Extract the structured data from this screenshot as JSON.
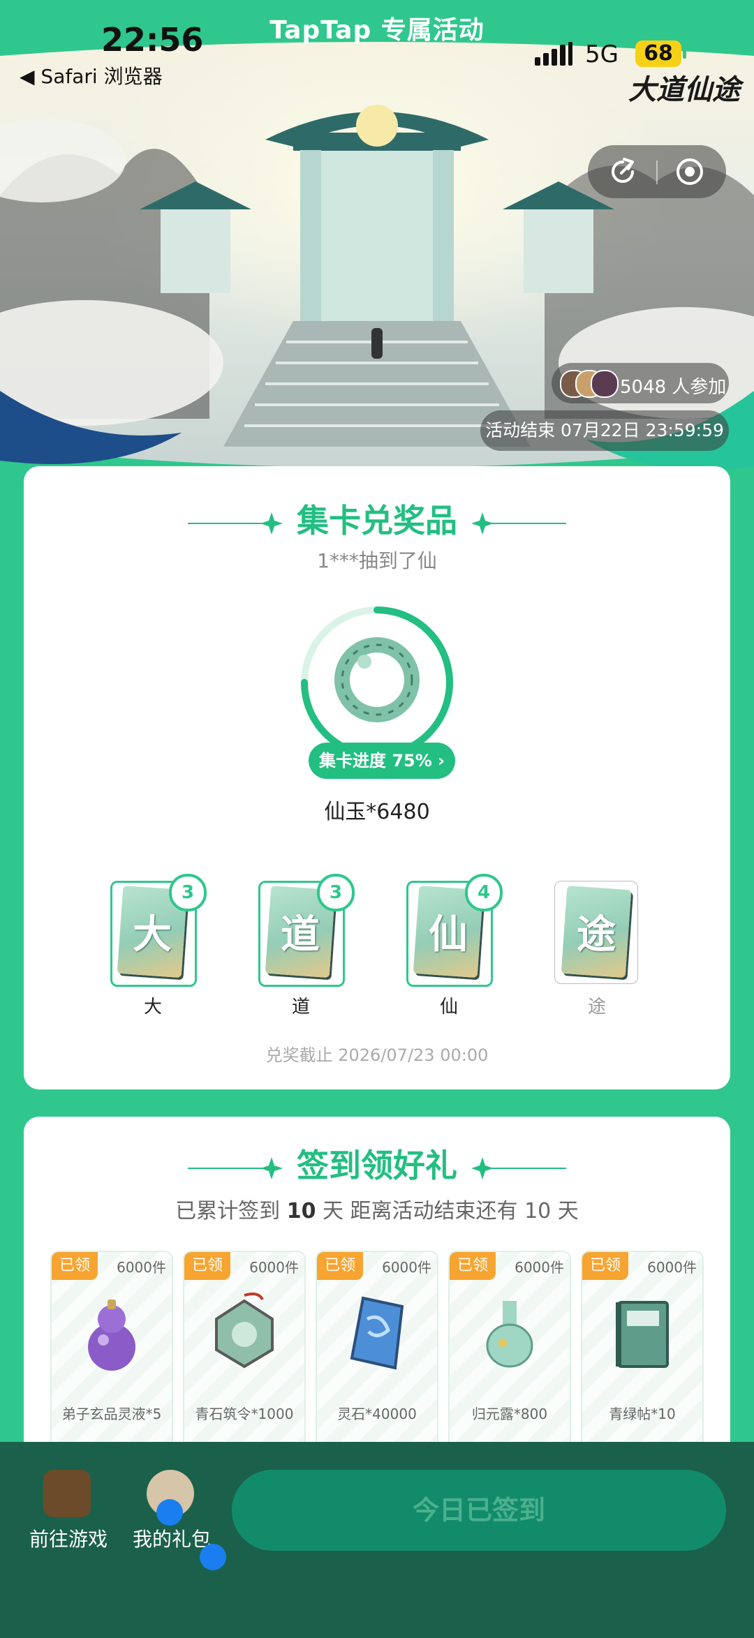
{
  "status_bar": {
    "time": "22:56",
    "network": "5G",
    "battery": "68",
    "back_label": "◀ Safari 浏览器"
  },
  "header": {
    "brand": "TapTap 专属活动",
    "logo_text": "大道仙途"
  },
  "event_meta": {
    "participants": "5048 人参加",
    "end_time": "活动结束 07月22日 23:59:59"
  },
  "collect": {
    "title": "集卡兑奖品",
    "ticker": "1***抽到了仙",
    "progress_label": "集卡进度 75% ›",
    "progress_fraction": 0.75,
    "reward_name": "仙玉*6480",
    "cards": [
      {
        "glyph": "大",
        "label": "大",
        "count": "3",
        "owned": true
      },
      {
        "glyph": "道",
        "label": "道",
        "count": "3",
        "owned": true
      },
      {
        "glyph": "仙",
        "label": "仙",
        "count": "4",
        "owned": true
      },
      {
        "glyph": "途",
        "label": "途",
        "count": "",
        "owned": false
      }
    ],
    "redeem_deadline": "兑奖截止 2026/07/23 00:00"
  },
  "signin": {
    "title": "签到领好礼",
    "days_prefix": "已累计签到",
    "days": "10",
    "days_suffix": "天  距离活动结束还有 10 天",
    "items": [
      {
        "tag": "已领",
        "stock": "6000件",
        "name": "弟子玄品灵液*5",
        "icon": "purple-gourd-icon",
        "color": "#8b5cc8"
      },
      {
        "tag": "已领",
        "stock": "6000件",
        "name": "青石筑令*1000",
        "icon": "stone-token-icon",
        "color": "#8fbfa8"
      },
      {
        "tag": "已领",
        "stock": "6000件",
        "name": "灵石*40000",
        "icon": "spirit-stone-icon",
        "color": "#4d8fd6"
      },
      {
        "tag": "已领",
        "stock": "6000件",
        "name": "归元露*800",
        "icon": "jade-vase-icon",
        "color": "#9fd6c4"
      },
      {
        "tag": "已领",
        "stock": "6000件",
        "name": "青绿帖*10",
        "icon": "green-book-icon",
        "color": "#5f9c8a"
      }
    ]
  },
  "bottom_bar": {
    "go_game": "前往游戏",
    "my_gifts": "我的礼包",
    "signin_button": "今日已签到"
  }
}
